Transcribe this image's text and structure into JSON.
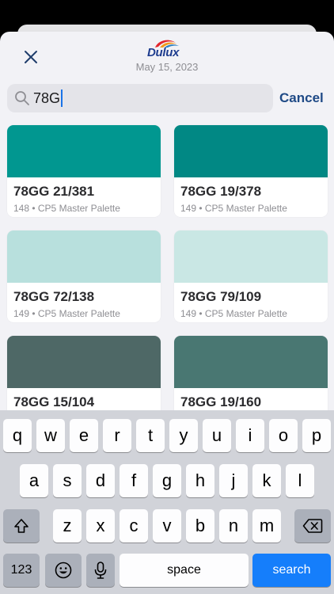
{
  "header": {
    "brand": "Dulux",
    "date": "May 15, 2023"
  },
  "search": {
    "value": "78G",
    "cancel_label": "Cancel"
  },
  "colors": [
    {
      "name": "78GG 21/381",
      "meta": "148 • CP5 Master Palette",
      "hex": "#019790"
    },
    {
      "name": "78GG 19/378",
      "meta": "149 • CP5 Master Palette",
      "hex": "#018884"
    },
    {
      "name": "78GG 72/138",
      "meta": "149 • CP5 Master Palette",
      "hex": "#b8e0dd"
    },
    {
      "name": "78GG 79/109",
      "meta": "149 • CP5 Master Palette",
      "hex": "#c9e7e4"
    },
    {
      "name": "78GG 15/104",
      "meta": "",
      "hex": "#4e6866"
    },
    {
      "name": "78GG 19/160",
      "meta": "",
      "hex": "#497772"
    }
  ],
  "keyboard": {
    "row1": [
      "q",
      "w",
      "e",
      "r",
      "t",
      "y",
      "u",
      "i",
      "o",
      "p"
    ],
    "row2": [
      "a",
      "s",
      "d",
      "f",
      "g",
      "h",
      "j",
      "k",
      "l"
    ],
    "row3": [
      "z",
      "x",
      "c",
      "v",
      "b",
      "n",
      "m"
    ],
    "numbers_label": "123",
    "space_label": "space",
    "search_label": "search"
  }
}
